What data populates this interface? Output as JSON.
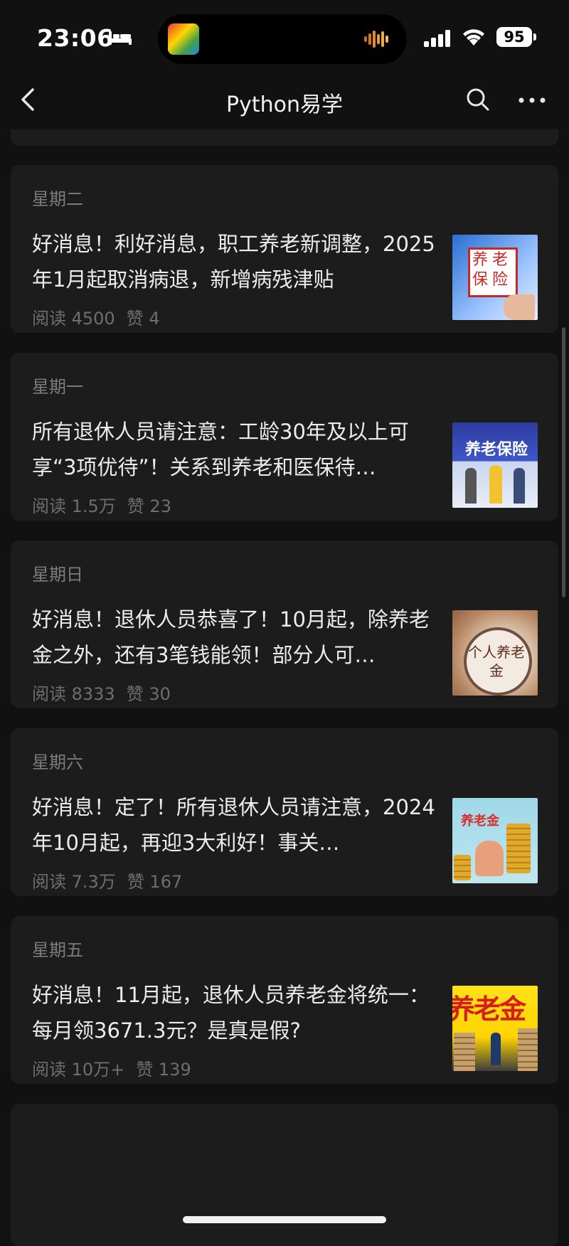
{
  "status": {
    "time": "23:06",
    "battery": "95"
  },
  "nav": {
    "title": "Python易学"
  },
  "articles": [
    {
      "day": "星期二",
      "title": "好消息！利好消息，职工养老新调整，2025年1月起取消病退，新增病残津贴",
      "reads": "阅读 4500",
      "likes": "赞 4",
      "thumb_text": "养老保险"
    },
    {
      "day": "星期一",
      "title": "所有退休人员请注意：工龄30年及以上可享“3项优待”！关系到养老和医保待…",
      "reads": "阅读 1.5万",
      "likes": "赞 23",
      "thumb_text": "养老保险"
    },
    {
      "day": "星期日",
      "title": "好消息！退休人员恭喜了！10月起，除养老金之外，还有3笔钱能领！部分人可…",
      "reads": "阅读 8333",
      "likes": "赞 30",
      "thumb_text": "个人养老金"
    },
    {
      "day": "星期六",
      "title": "好消息！定了！所有退休人员请注意，2024年10月起，再迎3大利好！事关…",
      "reads": "阅读 7.3万",
      "likes": "赞 167",
      "thumb_text": "养老金"
    },
    {
      "day": "星期五",
      "title": "好消息！11月起，退休人员养老金将统一：每月领3671.3元？是真是假?",
      "reads": "阅读 10万+",
      "likes": "赞 139",
      "thumb_text": "养老金"
    }
  ]
}
